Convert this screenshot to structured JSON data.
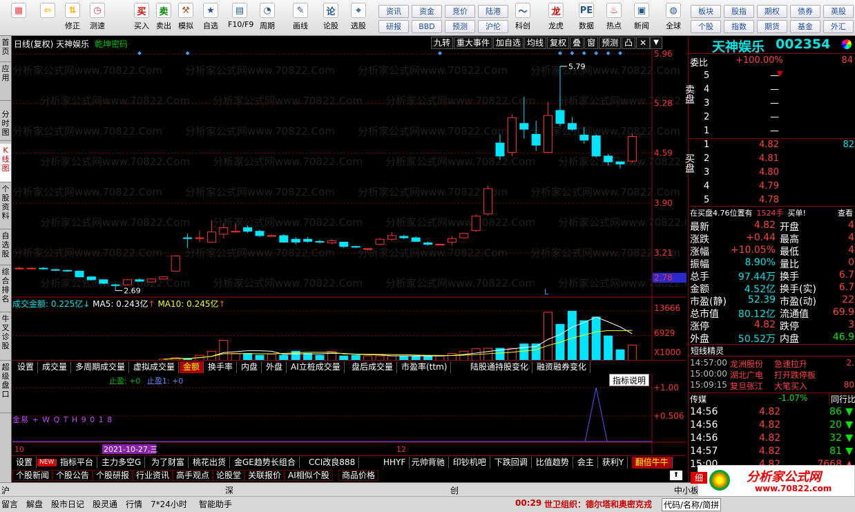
{
  "toolbar": {
    "big": [
      {
        "label": "",
        "icon": "grid-icon"
      },
      {
        "label": "",
        "icon": "back-arrow-icon"
      },
      {
        "label": "修正",
        "icon": "up-down-arrows-icon"
      },
      {
        "label": "测速",
        "icon": "clock-icon"
      },
      {
        "label": "买入",
        "icon": "buy-icon",
        "glyph": "买"
      },
      {
        "label": "卖出",
        "icon": "sell-icon",
        "glyph": "卖"
      },
      {
        "label": "模拟",
        "icon": "hammer-icon"
      },
      {
        "label": "自选",
        "icon": "star-icon"
      },
      {
        "label": "F10/F9",
        "icon": "f10-icon"
      },
      {
        "label": "周期",
        "icon": "period-icon"
      },
      {
        "label": "画线",
        "icon": "pencil-icon"
      },
      {
        "label": "论股",
        "icon": "discuss-icon",
        "glyph": "论"
      },
      {
        "label": "选股",
        "icon": "select-stock-icon"
      },
      {
        "label": "科创",
        "icon": "sci-tech-icon"
      },
      {
        "label": "龙虎",
        "icon": "dragon-tiger-icon",
        "glyph": "龙"
      },
      {
        "label": "数据",
        "icon": "data-icon",
        "glyph": "PE"
      },
      {
        "label": "热点",
        "icon": "hot-icon"
      },
      {
        "label": "新闻",
        "icon": "news-icon"
      },
      {
        "label": "全球",
        "icon": "globe-icon"
      }
    ],
    "small_top": [
      "资讯",
      "资金",
      "竞价",
      "陆港",
      "板块",
      "股指",
      "期权",
      "债券",
      "英股"
    ],
    "small_bottom": [
      "研报",
      "BBD",
      "预测",
      "沪伦",
      "个股",
      "指数",
      "期货",
      "基金",
      "外汇"
    ]
  },
  "left_tabs": [
    "首页",
    "应用",
    "分时图",
    "K线图",
    "个股资料",
    "自选股",
    "综合排名",
    "牛叉诊股",
    "超级盘口"
  ],
  "chart": {
    "header": {
      "title": "日线(复权) 天神娱乐",
      "sub": "乾坤密码"
    },
    "top_buttons": [
      "九转",
      "重大事件",
      "加自选",
      "均线",
      "复权",
      "叠",
      "窗",
      "预测",
      "凸"
    ],
    "price_axis": [
      "5.96",
      "5.28",
      "4.59",
      "3.90",
      "3.21",
      "2.78"
    ],
    "annot_high": "5.79",
    "annot_low": "2.69",
    "marker_L": "L",
    "vol_header": {
      "name": "成交金额:",
      "v1": "0.225亿",
      "ma5": "MA5: 0.243亿",
      "ma10": "MA10: 0.245亿"
    },
    "vol_axis": [
      "13666",
      "6929",
      "X1000"
    ],
    "ind_header": {
      "a": "止盈: +0",
      "b": "止盈1: +0",
      "btn": "指标说明"
    },
    "ind_axis": [
      "+1.00",
      "+0.506"
    ],
    "ind_text": "金易 + W Q T H 9 0 1 8",
    "date_axis": {
      "left": "10",
      "mid": "12",
      "cursor": "2021-10-27,三"
    },
    "watermark": "分析家公式网www.70822.Com"
  },
  "chart_data": {
    "type": "candlestick",
    "candles": [
      {
        "o": 3.0,
        "c": 3.0,
        "h": 3.02,
        "l": 2.98
      },
      {
        "o": 3.0,
        "c": 3.0,
        "h": 3.01,
        "l": 2.99
      },
      {
        "o": 3.0,
        "c": 2.99,
        "h": 3.01,
        "l": 2.98
      },
      {
        "o": 2.98,
        "c": 2.97,
        "h": 2.99,
        "l": 2.96
      },
      {
        "o": 2.97,
        "c": 2.96,
        "h": 2.98,
        "l": 2.95
      },
      {
        "o": 2.96,
        "c": 2.88,
        "h": 2.96,
        "l": 2.87
      },
      {
        "o": 2.88,
        "c": 2.84,
        "h": 2.89,
        "l": 2.83
      },
      {
        "o": 2.84,
        "c": 2.79,
        "h": 2.85,
        "l": 2.78
      },
      {
        "o": 2.77,
        "c": 2.76,
        "h": 2.78,
        "l": 2.69
      },
      {
        "o": 2.77,
        "c": 2.84,
        "h": 2.85,
        "l": 2.76
      },
      {
        "o": 2.84,
        "c": 2.82,
        "h": 2.86,
        "l": 2.81
      },
      {
        "o": 2.81,
        "c": 2.85,
        "h": 2.86,
        "l": 2.8
      },
      {
        "o": 2.85,
        "c": 2.88,
        "h": 2.89,
        "l": 2.84
      },
      {
        "o": 2.96,
        "c": 3.17,
        "h": 3.18,
        "l": 2.95
      },
      {
        "o": 3.42,
        "c": 3.41,
        "h": 3.48,
        "l": 3.28
      },
      {
        "o": 3.42,
        "c": 3.42,
        "h": 3.52,
        "l": 3.36
      },
      {
        "o": 3.36,
        "c": 3.5,
        "h": 3.66,
        "l": 3.35
      },
      {
        "o": 3.47,
        "c": 3.56,
        "h": 3.62,
        "l": 3.41
      },
      {
        "o": 3.5,
        "c": 3.51,
        "h": 3.62,
        "l": 3.49
      },
      {
        "o": 3.56,
        "c": 3.51,
        "h": 3.59,
        "l": 3.49
      },
      {
        "o": 3.51,
        "c": 3.45,
        "h": 3.53,
        "l": 3.43
      },
      {
        "o": 3.45,
        "c": 3.45,
        "h": 3.47,
        "l": 3.44
      },
      {
        "o": 3.45,
        "c": 3.36,
        "h": 3.47,
        "l": 3.35
      },
      {
        "o": 3.4,
        "c": 3.36,
        "h": 3.43,
        "l": 3.33
      },
      {
        "o": 3.4,
        "c": 3.37,
        "h": 3.43,
        "l": 3.35
      },
      {
        "o": 3.37,
        "c": 3.36,
        "h": 3.39,
        "l": 3.34
      },
      {
        "o": 3.35,
        "c": 3.38,
        "h": 3.4,
        "l": 3.33
      },
      {
        "o": 3.36,
        "c": 3.3,
        "h": 3.36,
        "l": 3.28
      },
      {
        "o": 3.3,
        "c": 3.29,
        "h": 3.31,
        "l": 3.28
      },
      {
        "o": 3.27,
        "c": 3.27,
        "h": 3.27,
        "l": 3.24
      },
      {
        "o": 3.33,
        "c": 3.4,
        "h": 3.42,
        "l": 3.32
      },
      {
        "o": 3.4,
        "c": 3.45,
        "h": 3.5,
        "l": 3.38
      },
      {
        "o": 3.44,
        "c": 3.42,
        "h": 3.46,
        "l": 3.4
      },
      {
        "o": 3.42,
        "c": 3.37,
        "h": 3.44,
        "l": 3.37
      },
      {
        "o": 3.35,
        "c": 3.33,
        "h": 3.37,
        "l": 3.31
      },
      {
        "o": 3.33,
        "c": 3.33,
        "h": 3.34,
        "l": 3.32
      },
      {
        "o": 3.36,
        "c": 3.41,
        "h": 3.44,
        "l": 3.32
      },
      {
        "o": 3.42,
        "c": 3.48,
        "h": 3.49,
        "l": 3.41
      },
      {
        "o": 3.52,
        "c": 3.72,
        "h": 3.74,
        "l": 3.5
      },
      {
        "o": 3.75,
        "c": 4.1,
        "h": 4.14,
        "l": 3.73
      },
      {
        "o": 4.73,
        "c": 4.55,
        "h": 4.85,
        "l": 4.5
      },
      {
        "o": 4.6,
        "c": 5.08,
        "h": 5.13,
        "l": 4.55
      },
      {
        "o": 5.0,
        "c": 4.92,
        "h": 5.37,
        "l": 4.79
      },
      {
        "o": 4.85,
        "c": 4.7,
        "h": 5.04,
        "l": 4.62
      },
      {
        "o": 4.6,
        "c": 5.11,
        "h": 5.3,
        "l": 4.6
      },
      {
        "o": 5.18,
        "c": 5.0,
        "h": 5.79,
        "l": 4.96
      },
      {
        "o": 5.0,
        "c": 4.92,
        "h": 5.09,
        "l": 4.9
      },
      {
        "o": 4.84,
        "c": 4.77,
        "h": 4.95,
        "l": 4.72
      },
      {
        "o": 4.83,
        "c": 4.55,
        "h": 4.85,
        "l": 4.53
      },
      {
        "o": 4.55,
        "c": 4.47,
        "h": 4.58,
        "l": 4.42
      },
      {
        "o": 4.47,
        "c": 4.44,
        "h": 4.47,
        "l": 4.38
      },
      {
        "o": 4.48,
        "c": 4.82,
        "h": 4.86,
        "l": 4.46
      }
    ],
    "volume_amount": [
      0.4,
      0.8,
      0.6,
      1.5,
      2.6,
      5.6,
      2.0,
      2.0,
      1.5,
      1.8,
      1.5,
      2.6,
      2.0,
      1.5,
      2.6,
      1.3,
      1.5,
      1.3,
      1.3,
      1.3,
      1.3,
      1.3,
      1.3,
      1.3,
      2.0,
      2.6,
      3.3,
      3.4,
      3.4,
      3.4,
      4.6,
      4.6,
      13.3,
      10.0,
      13.6,
      11.0,
      12.0,
      6.8,
      3.0,
      4.3
    ],
    "ylim": [
      2.6,
      6.0
    ]
  },
  "quote": {
    "name": "天神娱乐",
    "code": "002354",
    "weibi_label": "委比",
    "weibi": "+100.00%",
    "weicha": "84",
    "sell_label": "卖盘",
    "buy_label": "买盘",
    "sell": [
      {
        "n": "5",
        "p": "—"
      },
      {
        "n": "4",
        "p": "—"
      },
      {
        "n": "3",
        "p": "—"
      },
      {
        "n": "2",
        "p": "—"
      },
      {
        "n": "1",
        "p": "—"
      }
    ],
    "buy": [
      {
        "n": "1",
        "p": "4.82",
        "v": "82"
      },
      {
        "n": "2",
        "p": "4.81",
        "v": ""
      },
      {
        "n": "3",
        "p": "4.80",
        "v": ""
      },
      {
        "n": "4",
        "p": "4.79",
        "v": ""
      },
      {
        "n": "5",
        "p": "4.78",
        "v": ""
      }
    ],
    "msg": {
      "a": "在买盘4.76位置有",
      "b": "1524手",
      "c": "买单!",
      "d": "查看"
    },
    "stats": [
      [
        "最新",
        "4.82",
        "开盘",
        "4"
      ],
      [
        "涨跌",
        "+0.44",
        "最高",
        "4"
      ],
      [
        "涨幅",
        "+10.05%",
        "最低",
        "4"
      ],
      [
        "振幅",
        "8.90%",
        "量比",
        "0"
      ],
      [
        "总手",
        "97.44万",
        "换手",
        "6.7"
      ],
      [
        "金额",
        "4.52亿",
        "换手(实)",
        "6.7"
      ],
      [
        "市盈(静)",
        "52.39",
        "市盈(动)",
        "22"
      ],
      [
        "总市值",
        "80.12亿",
        "流通值",
        "69.9"
      ],
      [
        "涨停",
        "4.82",
        "跌停",
        "3"
      ],
      [
        "外盘",
        "50.52万",
        "内盘",
        "46.9"
      ]
    ],
    "sprite_title": "短线精灵",
    "sprite": [
      [
        "14:57:00",
        "龙洲股份",
        "急速拉升",
        "2."
      ],
      [
        "15:00:00",
        "湖北广电",
        "打开跌停板",
        ""
      ],
      [
        "15:09:15",
        "复旦张江",
        "大笔买入",
        "80"
      ]
    ],
    "sector": {
      "name": "传媒",
      "chg": "-1.07%",
      "btn": "同行比"
    },
    "ticks": [
      [
        "14:56",
        "4.82",
        "86",
        "down"
      ],
      [
        "14:56",
        "4.82",
        "20",
        "down"
      ],
      [
        "14:56",
        "4.82",
        "32",
        "down"
      ],
      [
        "14:57",
        "4.82",
        "81",
        "down"
      ],
      [
        "15:00",
        "4.82",
        "7668",
        "up"
      ]
    ]
  },
  "tabs1": [
    "设置",
    "成交量",
    "多周期成交量",
    "虚拟成交量",
    "金额",
    "换手率",
    "内盘",
    "外盘",
    "AI立桩成交量",
    "盘后成交量",
    "市盈率(ttm)",
    "陆股通持股变化",
    "融资融券变化"
  ],
  "tabs2": [
    "设置",
    "NEW",
    "指标平台",
    "主力多空G",
    "为了财富",
    "桃花出货",
    "金GE趋势长组合",
    "CCI改良888",
    "HHYF",
    "元帅背驰",
    "印钞机吧",
    "下跌回调",
    "比值趋势",
    "会主",
    "获利Y",
    "翻倍牛牛"
  ],
  "tabs3": [
    "个股新闻",
    "个股公告",
    "个股研报",
    "行业资讯",
    "高手观点",
    "论股堂",
    "关联报价",
    "AI相似个股",
    "商品价格"
  ],
  "status": {
    "sh": "沪",
    "sz": "深",
    "cy": "创",
    "zx": "中小板",
    "logo": "分析家公式网",
    "site": "www.70822.com",
    "fen": "细"
  },
  "status2": {
    "items": [
      "留言",
      "解盘",
      "股市日记",
      "股灵通",
      "行情",
      "7*24小时",
      "智能助手"
    ],
    "news_time": "00:29",
    "news": "世卫组织：德尔塔和奥密克戎",
    "code_btn": "代码/名称/简拼"
  }
}
